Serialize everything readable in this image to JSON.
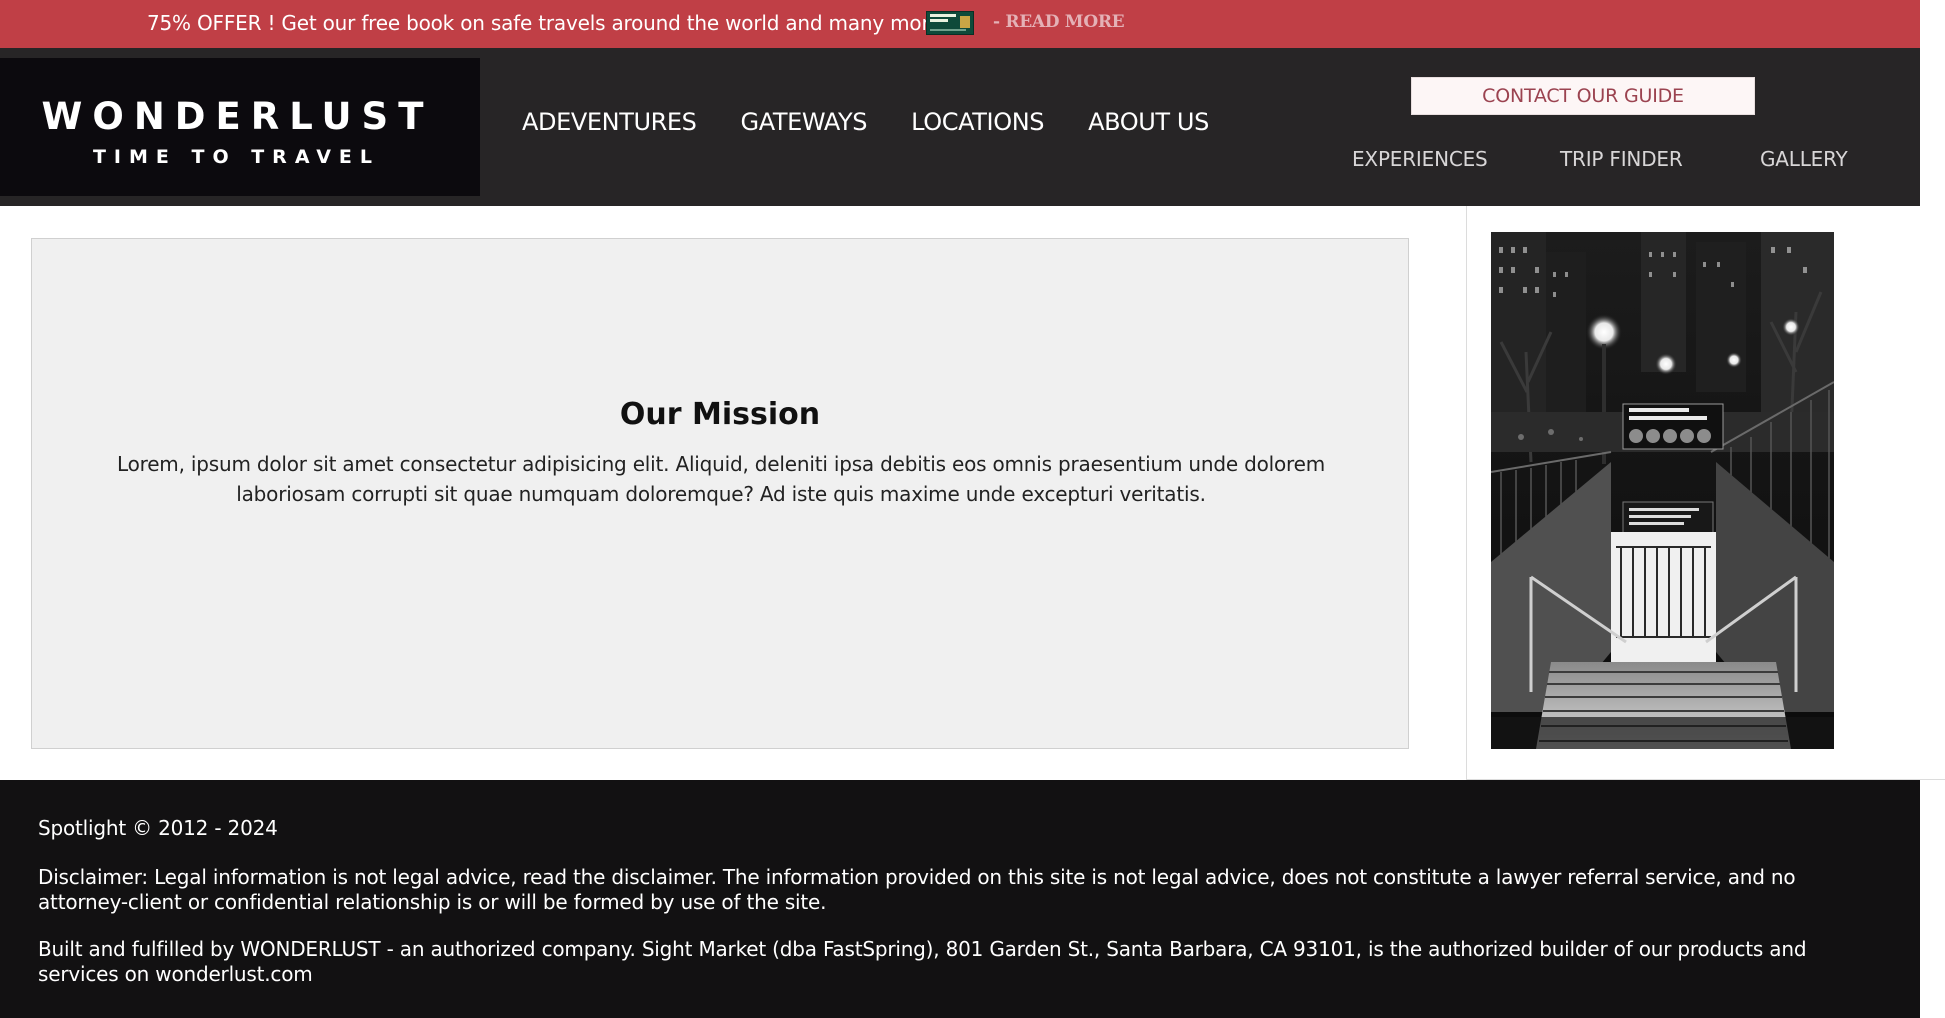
{
  "offer": {
    "text": "75% OFFER ! Get our free book on safe travels around the world and many more !",
    "book_title": "Have A Good Holiday",
    "read_more": "- READ MORE"
  },
  "brand": {
    "name": "WONDERLUST",
    "tagline": "TIME TO TRAVEL"
  },
  "nav": {
    "main": [
      "ADEVENTURES",
      "GATEWAYS",
      "LOCATIONS",
      "ABOUT US"
    ],
    "contact": "CONTACT OUR GUIDE",
    "secondary": [
      "EXPERIENCES",
      "TRIP FINDER",
      "GALLERY"
    ]
  },
  "mission": {
    "title": "Our Mission",
    "text": "Lorem, ipsum dolor sit amet consectetur adipisicing elit. Aliquid, deleniti ipsa debitis eos omnis praesentium unde dolorem laboriosam corrupti sit quae numquam doloremque? Ad iste quis maxime unde excepturi veritatis."
  },
  "photo": {
    "station_sign": "5 Avenue– Bryant Park Station",
    "lines": [
      "B",
      "D",
      "F",
      "M",
      "7"
    ],
    "notice": "Enter with or buy MetroCard at all times or see agent at 42 Street & 6 Avenue"
  },
  "footer": {
    "copyright": "Spotlight © 2012 - 2024",
    "disclaimer": "Disclaimer: Legal information is not legal advice, read the disclaimer. The information provided on this site is not legal advice, does not constitute a lawyer referral service, and no attorney-client or confidential relationship is or will be formed by use of the site.",
    "built_by": "Built and fulfilled by WONDERLUST - an authorized company. Sight Market (dba FastSpring), 801 Garden St., Santa Barbara, CA 93101, is the authorized builder of our products and services on wonderlust.com"
  },
  "colors": {
    "offer_bar": "#c03f46",
    "header": "#272526",
    "brand_block": "#0c0a0e",
    "contact_text": "#9b4350",
    "footer": "#121112"
  }
}
